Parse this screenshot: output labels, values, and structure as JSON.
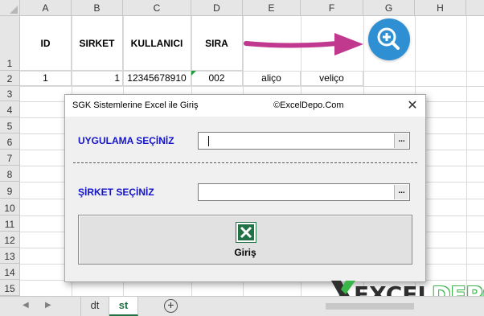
{
  "columns": [
    "A",
    "B",
    "C",
    "D",
    "E",
    "F",
    "G",
    "H"
  ],
  "rows": [
    "1",
    "2",
    "3",
    "4",
    "5",
    "6",
    "7",
    "8",
    "9",
    "10",
    "11",
    "12",
    "13",
    "14",
    "15"
  ],
  "header_row": {
    "id": "ID",
    "sirket": "SIRKET",
    "kullanici": "KULLANICI",
    "sira": "SIRA"
  },
  "data_row": {
    "id": "1",
    "sirket": "1",
    "kullanici": "12345678910",
    "sira": "002",
    "e": "aliço",
    "f": "veliço"
  },
  "dialog": {
    "title": "SGK Sistemlerine Excel ile Giriş",
    "brand": "©ExcelDepo.Com",
    "close": "✕",
    "uygulama_label": "UYGULAMA SEÇİNİZ",
    "sirket_label": "ŞİRKET SEÇİNİZ",
    "dropdown_glyph": "...",
    "login_label": "Giriş"
  },
  "watermark": {
    "part1": "EXCEL",
    "part2": "DEPO"
  },
  "tabs": {
    "prev": "◀",
    "next": "▶",
    "sheets": [
      "dt",
      "st"
    ],
    "add": "+"
  },
  "colors": {
    "accent_blue": "#2e8fd2",
    "arrow_magenta": "#c0398e",
    "label_blue": "#1414c8",
    "excel_green": "#217346"
  }
}
